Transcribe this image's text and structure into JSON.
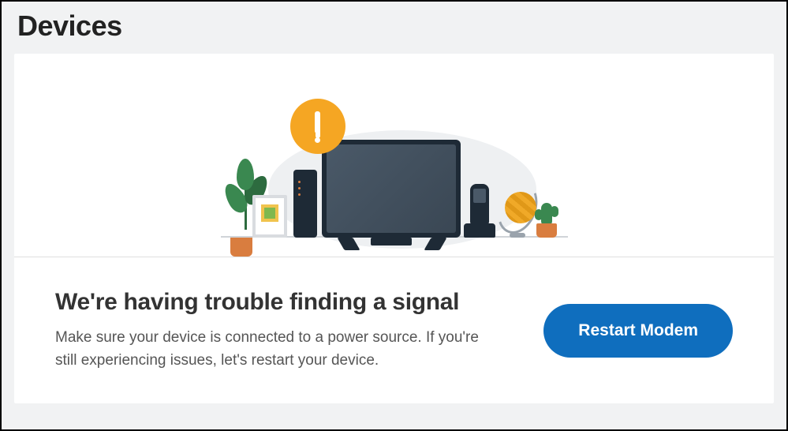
{
  "header": {
    "title": "Devices"
  },
  "alert": {
    "icon": "warning-icon",
    "heading": "We're having trouble finding a signal",
    "description": "Make sure your device is connected to a power source. If you're still experiencing issues, let's restart your device.",
    "action_label": "Restart Modem"
  },
  "colors": {
    "accent_warning": "#f5a623",
    "button_primary": "#0f6ebe"
  }
}
